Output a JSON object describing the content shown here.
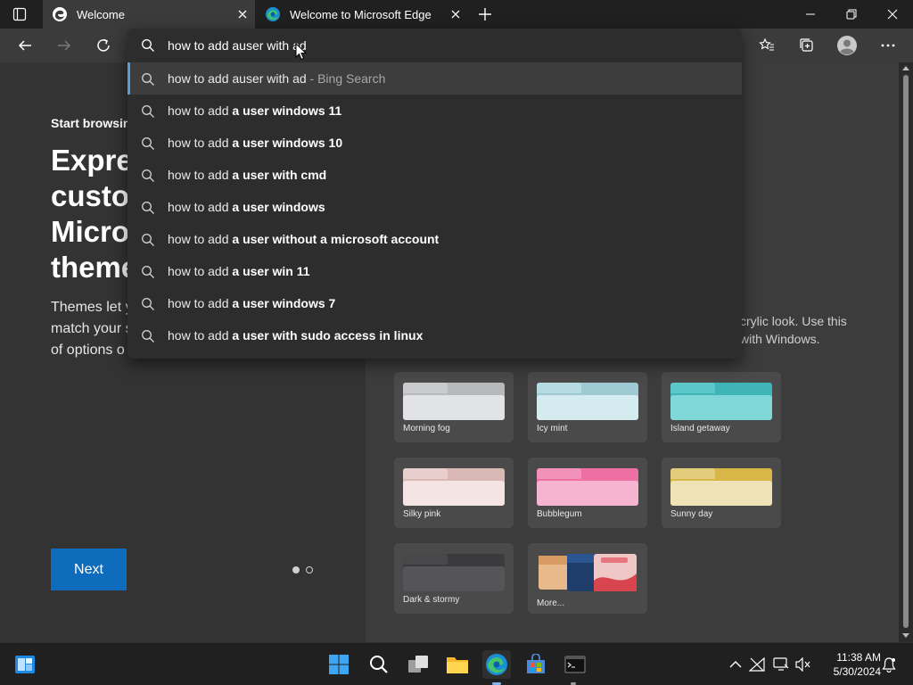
{
  "tabs": [
    {
      "label": "Welcome",
      "active": true
    },
    {
      "label": "Welcome to Microsoft Edge",
      "active": false
    }
  ],
  "address": {
    "value": "how to add auser with ad"
  },
  "suggestions": [
    {
      "prefix": "how to add auser with ad",
      "bold": "",
      "suffix": " - Bing Search",
      "selected": true
    },
    {
      "prefix": "how to add ",
      "bold": "a user windows 11",
      "suffix": ""
    },
    {
      "prefix": "how to add ",
      "bold": "a user windows 10",
      "suffix": ""
    },
    {
      "prefix": "how to add ",
      "bold": "a user with cmd",
      "suffix": ""
    },
    {
      "prefix": "how to add ",
      "bold": "a user windows",
      "suffix": ""
    },
    {
      "prefix": "how to add ",
      "bold": "a user without a microsoft account",
      "suffix": ""
    },
    {
      "prefix": "how to add ",
      "bold": "a user win 11",
      "suffix": ""
    },
    {
      "prefix": "how to add ",
      "bold": "a user windows 7",
      "suffix": ""
    },
    {
      "prefix": "how to add ",
      "bold": "a user with sudo access in linux",
      "suffix": ""
    }
  ],
  "page": {
    "start_label": "Start browsing",
    "heading_lines": [
      "Expres",
      "custor",
      "Micros",
      "theme"
    ],
    "body_lines": [
      "Themes let y",
      "match your s",
      "of options o"
    ],
    "right_desc_lines": [
      "crylic look. Use this",
      "with Windows."
    ],
    "next_label": "Next",
    "themes": [
      {
        "name": "Morning fog",
        "back": "#b7b9bd",
        "front": "#e2e3e6",
        "tab": "#c9cbce"
      },
      {
        "name": "Icy mint",
        "back": "#9fc9d3",
        "front": "#d4ecef",
        "tab": "#b7dbe2"
      },
      {
        "name": "Island getaway",
        "back": "#3fb5b8",
        "front": "#7fd7d8",
        "tab": "#5cc7c9"
      },
      {
        "name": "Silky pink",
        "back": "#d9b8b6",
        "front": "#f4e4e3",
        "tab": "#e8cfcd"
      },
      {
        "name": "Bubblegum",
        "back": "#ee6fa3",
        "front": "#f7b4d0",
        "tab": "#f291ba"
      },
      {
        "name": "Sunny day",
        "back": "#d8b648",
        "front": "#eee2b6",
        "tab": "#e3cc7c"
      },
      {
        "name": "Dark & stormy",
        "back": "#3b3b3e",
        "front": "#555559",
        "tab": "#48484b"
      },
      {
        "name": "More...",
        "back": "",
        "front": "",
        "tab": ""
      }
    ]
  },
  "taskbar": {
    "time": "11:38 AM",
    "date": "5/30/2024"
  },
  "colors": {
    "accent": "#0f6cbd",
    "selection_bar": "#5b9bd5"
  }
}
